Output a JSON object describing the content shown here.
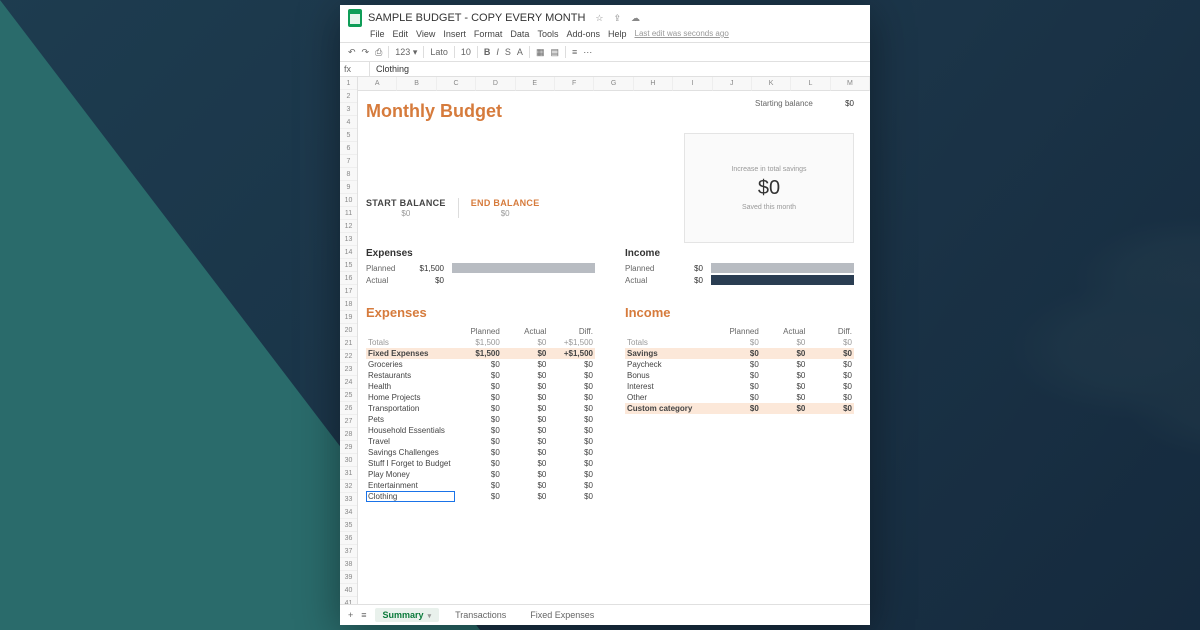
{
  "header": {
    "doc_title": "SAMPLE BUDGET - COPY EVERY MONTH",
    "last_edit": "Last edit was seconds ago"
  },
  "menu": [
    "File",
    "Edit",
    "View",
    "Insert",
    "Format",
    "Data",
    "Tools",
    "Add-ons",
    "Help"
  ],
  "toolbar": {
    "print": "⎙",
    "undo": "↶",
    "redo": "↷",
    "zoom": "123 ▾",
    "font": "Lato",
    "size": "10",
    "bold": "B",
    "italic": "I"
  },
  "formula": {
    "cell": "fx",
    "value": "Clothing"
  },
  "cols": [
    "A",
    "B",
    "C",
    "D",
    "E",
    "F",
    "G",
    "H",
    "I",
    "J",
    "K",
    "L",
    "M"
  ],
  "budget": {
    "title": "Monthly Budget",
    "starting_label": "Starting balance",
    "starting_value": "$0",
    "start_balance_label": "START BALANCE",
    "start_balance_value": "$0",
    "end_balance_label": "END BALANCE",
    "end_balance_value": "$0"
  },
  "savings": {
    "increase": "Increase in total savings",
    "amount": "$0",
    "saved": "Saved this month"
  },
  "summary": {
    "expenses": {
      "title": "Expenses",
      "planned_label": "Planned",
      "planned": "$1,500",
      "actual_label": "Actual",
      "actual": "$0"
    },
    "income": {
      "title": "Income",
      "planned_label": "Planned",
      "planned": "$0",
      "actual_label": "Actual",
      "actual": "$0"
    }
  },
  "expenses_table": {
    "title": "Expenses",
    "head": {
      "c0": "",
      "c1": "Planned",
      "c2": "Actual",
      "c3": "Diff."
    },
    "total": {
      "name": "Totals",
      "planned": "$1,500",
      "actual": "$0",
      "diff": "+$1,500"
    },
    "rows": [
      {
        "name": "Fixed Expenses",
        "planned": "$1,500",
        "actual": "$0",
        "diff": "+$1,500",
        "hl": true
      },
      {
        "name": "Groceries",
        "planned": "$0",
        "actual": "$0",
        "diff": "$0"
      },
      {
        "name": "Restaurants",
        "planned": "$0",
        "actual": "$0",
        "diff": "$0"
      },
      {
        "name": "Health",
        "planned": "$0",
        "actual": "$0",
        "diff": "$0"
      },
      {
        "name": "Home Projects",
        "planned": "$0",
        "actual": "$0",
        "diff": "$0"
      },
      {
        "name": "Transportation",
        "planned": "$0",
        "actual": "$0",
        "diff": "$0"
      },
      {
        "name": "Pets",
        "planned": "$0",
        "actual": "$0",
        "diff": "$0"
      },
      {
        "name": "Household Essentials",
        "planned": "$0",
        "actual": "$0",
        "diff": "$0"
      },
      {
        "name": "Travel",
        "planned": "$0",
        "actual": "$0",
        "diff": "$0"
      },
      {
        "name": "Savings Challenges",
        "planned": "$0",
        "actual": "$0",
        "diff": "$0"
      },
      {
        "name": "Stuff I Forget to Budget",
        "planned": "$0",
        "actual": "$0",
        "diff": "$0"
      },
      {
        "name": "Play Money",
        "planned": "$0",
        "actual": "$0",
        "diff": "$0"
      },
      {
        "name": "Entertainment",
        "planned": "$0",
        "actual": "$0",
        "diff": "$0"
      },
      {
        "name": "Clothing",
        "planned": "$0",
        "actual": "$0",
        "diff": "$0",
        "sel": true
      }
    ]
  },
  "income_table": {
    "title": "Income",
    "head": {
      "c0": "",
      "c1": "Planned",
      "c2": "Actual",
      "c3": "Diff."
    },
    "total": {
      "name": "Totals",
      "planned": "$0",
      "actual": "$0",
      "diff": "$0"
    },
    "rows": [
      {
        "name": "Savings",
        "planned": "$0",
        "actual": "$0",
        "diff": "$0",
        "hl": true
      },
      {
        "name": "Paycheck",
        "planned": "$0",
        "actual": "$0",
        "diff": "$0"
      },
      {
        "name": "Bonus",
        "planned": "$0",
        "actual": "$0",
        "diff": "$0"
      },
      {
        "name": "Interest",
        "planned": "$0",
        "actual": "$0",
        "diff": "$0"
      },
      {
        "name": "Other",
        "planned": "$0",
        "actual": "$0",
        "diff": "$0"
      },
      {
        "name": "Custom category",
        "planned": "$0",
        "actual": "$0",
        "diff": "$0",
        "hl": true
      }
    ]
  },
  "tabs": {
    "active": "Summary",
    "others": [
      "Transactions",
      "Fixed Expenses"
    ]
  }
}
